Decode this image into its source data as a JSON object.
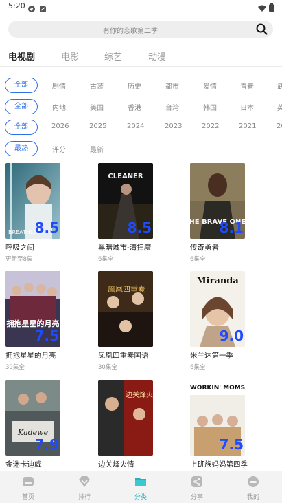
{
  "status_bar": {
    "time": "5:20"
  },
  "search": {
    "placeholder": "有你的恋歌第二季"
  },
  "tabs": [
    {
      "label": "电视剧",
      "active": true
    },
    {
      "label": "电影"
    },
    {
      "label": "综艺"
    },
    {
      "label": "动漫"
    }
  ],
  "filters": {
    "genre": [
      "全部",
      "剧情",
      "古装",
      "历史",
      "都市",
      "爱情",
      "青春",
      "武"
    ],
    "region": [
      "全部",
      "内地",
      "美国",
      "香港",
      "台湾",
      "韩国",
      "日本",
      "英"
    ],
    "year": [
      "全部",
      "2026",
      "2025",
      "2024",
      "2023",
      "2022",
      "2021",
      "20"
    ],
    "sort": [
      "最热",
      "评分",
      "最新"
    ]
  },
  "shows": [
    {
      "title": "呼吸之间",
      "sub": "更新至8集",
      "score": "8.5",
      "poster_text": "BREATHLESS"
    },
    {
      "title": "黑暗城市-清扫魔",
      "sub": "6集全",
      "score": "8.5",
      "poster_text": "CLEANER"
    },
    {
      "title": "传奇勇者",
      "sub": "6集全",
      "score": "8.1",
      "poster_text": "THE BRAVE ONES"
    },
    {
      "title": "拥抱星星的月亮",
      "sub": "39集全",
      "score": "7.5",
      "poster_text": "拥抱星星的月亮"
    },
    {
      "title": "凤凰四重奏国语",
      "sub": "30集全",
      "score": "",
      "poster_text": "鳳凰四重奏"
    },
    {
      "title": "米兰达第一季",
      "sub": "6集全",
      "score": "9.0",
      "poster_text": "Miranda"
    },
    {
      "title": "金迷卡迪威",
      "sub": "",
      "score": "7.9",
      "poster_text": "Kadewe"
    },
    {
      "title": "边关烽火情",
      "sub": "",
      "score": "",
      "poster_text": "边关烽火"
    },
    {
      "title": "上班族妈妈第四季",
      "sub": "",
      "score": "7.5",
      "poster_text": "WORKIN' MOMS"
    }
  ],
  "bottom_nav": [
    {
      "label": "首页",
      "icon": "home-icon"
    },
    {
      "label": "排行",
      "icon": "ranking-icon"
    },
    {
      "label": "分类",
      "icon": "category-icon",
      "active": true
    },
    {
      "label": "分享",
      "icon": "share-icon"
    },
    {
      "label": "我的",
      "icon": "profile-icon"
    }
  ],
  "colors": {
    "accent": "#2f6fe8",
    "score": "#1e4bff",
    "nav_active": "#29b0b8"
  }
}
